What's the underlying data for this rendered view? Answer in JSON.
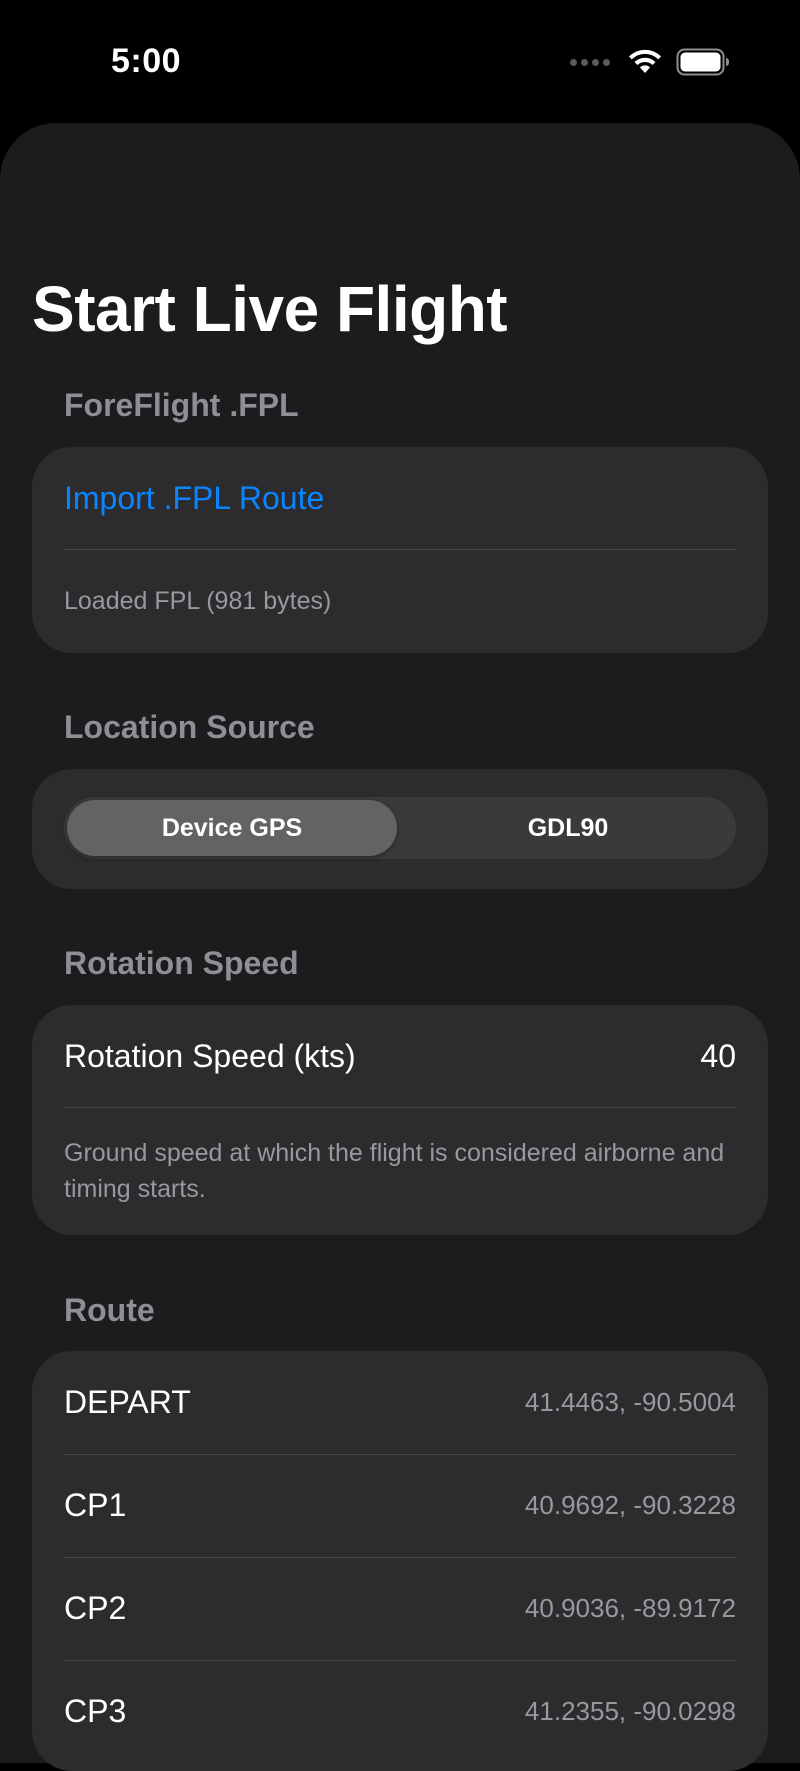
{
  "status": {
    "time": "5:00",
    "icons": [
      "signal-dots-icon",
      "wifi-icon",
      "battery-icon"
    ]
  },
  "title": "Start Live Flight",
  "foreflight": {
    "header": "ForeFlight .FPL",
    "import_label": "Import .FPL Route",
    "loaded_text": "Loaded FPL (981 bytes)"
  },
  "location": {
    "header": "Location Source",
    "options": [
      "Device GPS",
      "GDL90"
    ],
    "selected": "Device GPS"
  },
  "rotation": {
    "header": "Rotation Speed",
    "label": "Rotation Speed (kts)",
    "value": "40",
    "footer": "Ground speed at which the flight is considered airborne and timing starts."
  },
  "route": {
    "header": "Route",
    "points": [
      {
        "name": "DEPART",
        "coords": "41.4463, -90.5004"
      },
      {
        "name": "CP1",
        "coords": "40.9692, -90.3228"
      },
      {
        "name": "CP2",
        "coords": "40.9036, -89.9172"
      },
      {
        "name": "CP3",
        "coords": "41.2355, -90.0298"
      }
    ]
  },
  "colors": {
    "accent": "#0a84ff",
    "background": "#1c1c1e",
    "card": "#2c2c2e",
    "secondary_text": "#8e8e93"
  }
}
